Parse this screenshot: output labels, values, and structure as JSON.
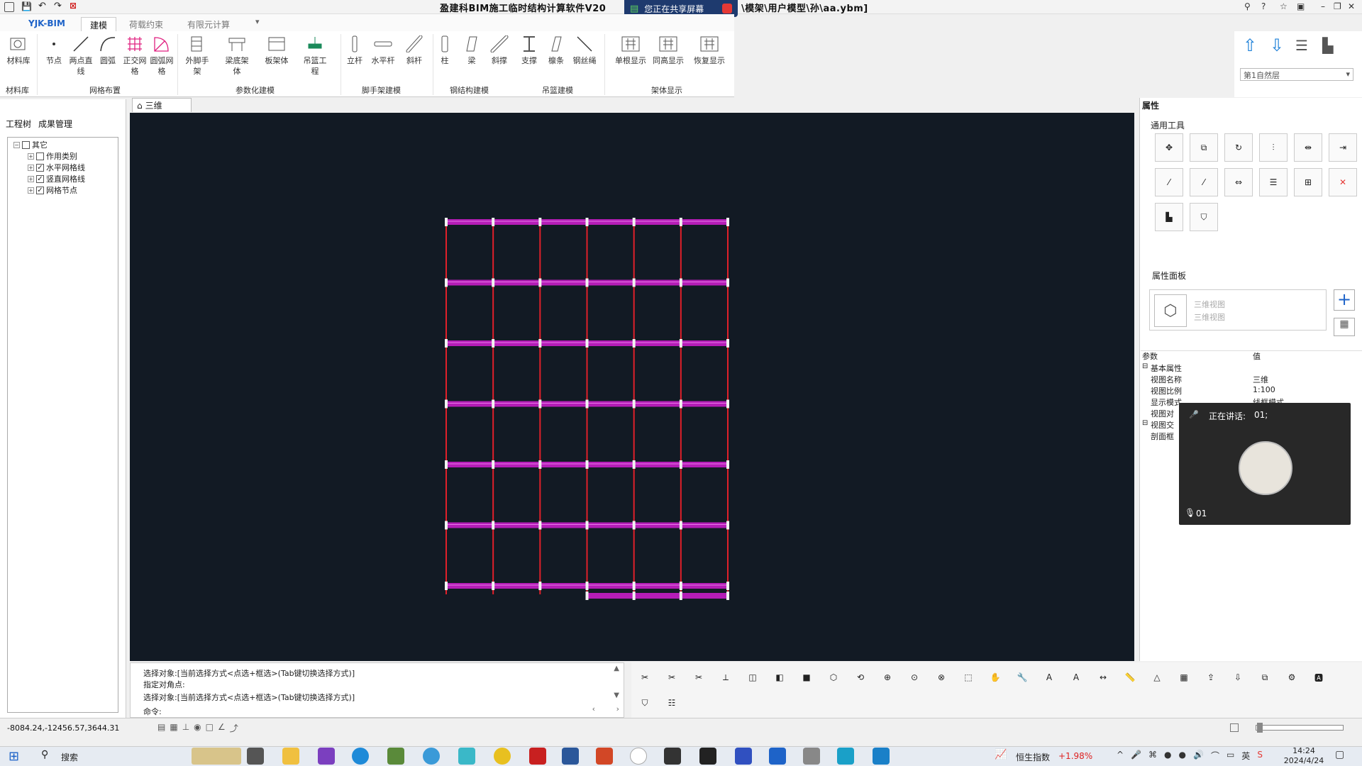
{
  "window": {
    "title": "盈建科BIM施工临时结构计算软件V20",
    "title_path": "\\模架\\用户模型\\孙\\aa.ybm]",
    "sharing_text": "您正在共享屏幕"
  },
  "tabs": [
    {
      "label": "YJK-BIM"
    },
    {
      "label": "建模"
    },
    {
      "label": "荷载约束"
    },
    {
      "label": "有限元计算"
    }
  ],
  "ribbon": {
    "buttons": [
      {
        "label": "材料库"
      },
      {
        "label": "节点"
      },
      {
        "label": "两点直线"
      },
      {
        "label": "圆弧"
      },
      {
        "label": "正交网格"
      },
      {
        "label": "圆弧网格"
      },
      {
        "label": "外脚手架"
      },
      {
        "label": "梁底架体"
      },
      {
        "label": "板架体"
      },
      {
        "label": "吊篮工程"
      },
      {
        "label": "立杆"
      },
      {
        "label": "水平杆"
      },
      {
        "label": "斜杆"
      },
      {
        "label": "柱"
      },
      {
        "label": "梁"
      },
      {
        "label": "斜撑"
      },
      {
        "label": "支撑"
      },
      {
        "label": "檩条"
      },
      {
        "label": "钢丝绳"
      },
      {
        "label": "单根显示"
      },
      {
        "label": "同高显示"
      },
      {
        "label": "恢复显示"
      }
    ],
    "groups": [
      {
        "label": "材料库"
      },
      {
        "label": "网格布置"
      },
      {
        "label": "参数化建模"
      },
      {
        "label": "脚手架建模"
      },
      {
        "label": "钢结构建模"
      },
      {
        "label": "吊篮建模"
      },
      {
        "label": "架体显示"
      }
    ],
    "floor_select": "第1自然层"
  },
  "left_panel": {
    "tabs": [
      {
        "label": "工程树"
      },
      {
        "label": "成果管理"
      }
    ],
    "tree": [
      {
        "label": "其它",
        "checked": false,
        "level": 0
      },
      {
        "label": "作用类别",
        "checked": false,
        "level": 1
      },
      {
        "label": "水平网格线",
        "checked": true,
        "level": 1
      },
      {
        "label": "竖直网格线",
        "checked": true,
        "level": 1
      },
      {
        "label": "网格节点",
        "checked": true,
        "level": 1
      }
    ]
  },
  "viewport": {
    "tab_label": "三维",
    "colors": {
      "background": "#121a24",
      "vertical": "#e0202a",
      "horizontal": "#c81ec8",
      "node": "#f2f2f2"
    },
    "grid": {
      "columns": 7,
      "rows": 7
    }
  },
  "command": {
    "lines": [
      "选择对象:[当前选择方式<点选+框选>(Tab键切换选择方式)]",
      "指定对角点:",
      "选择对象:[当前选择方式<点选+框选>(Tab键切换选择方式)]"
    ],
    "prompt": "命令:"
  },
  "status": {
    "coords": "-8084.24,-12456.57,3644.31"
  },
  "properties": {
    "title": "属性",
    "tools_title": "通用工具",
    "panel_title": "属性面板",
    "card_line1": "三维视图",
    "card_line2": "三维视图",
    "col_param": "参数",
    "col_value": "值",
    "rows": [
      {
        "name": "基本属性",
        "value": "",
        "group": true
      },
      {
        "name": "视图名称",
        "value": "三维"
      },
      {
        "name": "视图比例",
        "value": "1:100"
      },
      {
        "name": "显示模式",
        "value": "线框模式"
      },
      {
        "name": "视图对",
        "value": ""
      },
      {
        "name": "视图交",
        "value": "",
        "group": true
      },
      {
        "name": "剖面框",
        "value": ""
      }
    ]
  },
  "call": {
    "speaking": "正在讲话:",
    "speaker": "01;",
    "name": "01"
  },
  "taskbar": {
    "search": "搜索",
    "stock_name": "恒生指数",
    "stock_change": "+1.98%",
    "ime": "英",
    "time": "14:24",
    "date": "2024/4/24"
  }
}
